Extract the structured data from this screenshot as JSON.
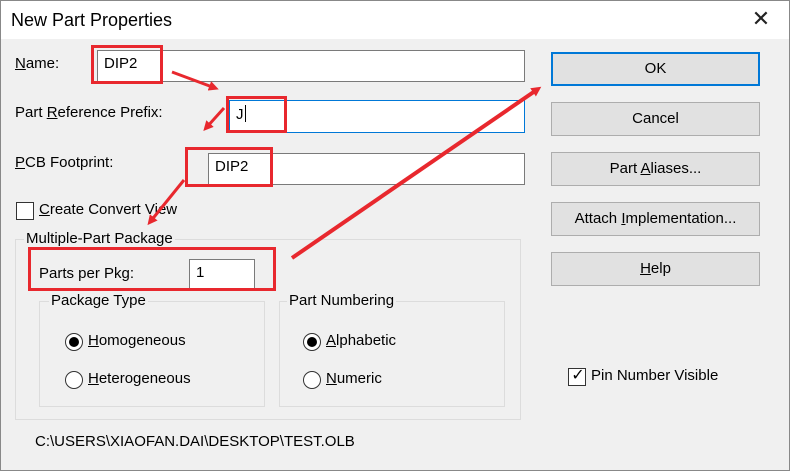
{
  "window": {
    "title": "New Part Properties",
    "close_glyph": "✕"
  },
  "fields": {
    "name": {
      "label_prefix": "",
      "label_key": "N",
      "label_rest": "ame:",
      "value": "DIP2"
    },
    "prefix": {
      "label_prefix": "Part ",
      "label_key": "R",
      "label_rest": "eference Prefix:",
      "value": "J"
    },
    "footprint": {
      "label_prefix": "",
      "label_key": "P",
      "label_rest": "CB Footprint:",
      "value": "DIP2"
    }
  },
  "create_convert": {
    "label_key": "C",
    "label_rest": "reate Convert View",
    "checked": false
  },
  "multi_part": {
    "group_label": "Multiple-Part Package",
    "parts_label": "Parts per Pkg:",
    "parts_value": "1",
    "package_type": {
      "label": "Package Type",
      "options": [
        {
          "key": "H",
          "rest": "omogeneous",
          "selected": true
        },
        {
          "key": "H",
          "rest": "eterogeneous",
          "selected": false
        }
      ]
    },
    "part_numbering": {
      "label": "Part Numbering",
      "options": [
        {
          "key": "A",
          "rest": "lphabetic",
          "selected": true
        },
        {
          "key": "N",
          "rest": "umeric",
          "selected": false
        }
      ]
    }
  },
  "buttons": {
    "ok": {
      "pre": "",
      "key": "",
      "rest": "OK"
    },
    "cancel": {
      "pre": "",
      "key": "",
      "rest": "Cancel"
    },
    "aliases": {
      "pre": "Part ",
      "key": "A",
      "rest": "liases..."
    },
    "attach": {
      "pre": "Attach ",
      "key": "I",
      "rest": "mplementation..."
    },
    "help": {
      "pre": "",
      "key": "H",
      "rest": "elp"
    }
  },
  "pin_number_visible": {
    "label": "Pin Number Visible",
    "checked": true
  },
  "path": "C:\\USERS\\XIAOFAN.DAI\\DESKTOP\\TEST.OLB",
  "colors": {
    "annotation": "#e8282e",
    "focus": "#0078d7",
    "dialog_bg": "#f0f0f0"
  }
}
